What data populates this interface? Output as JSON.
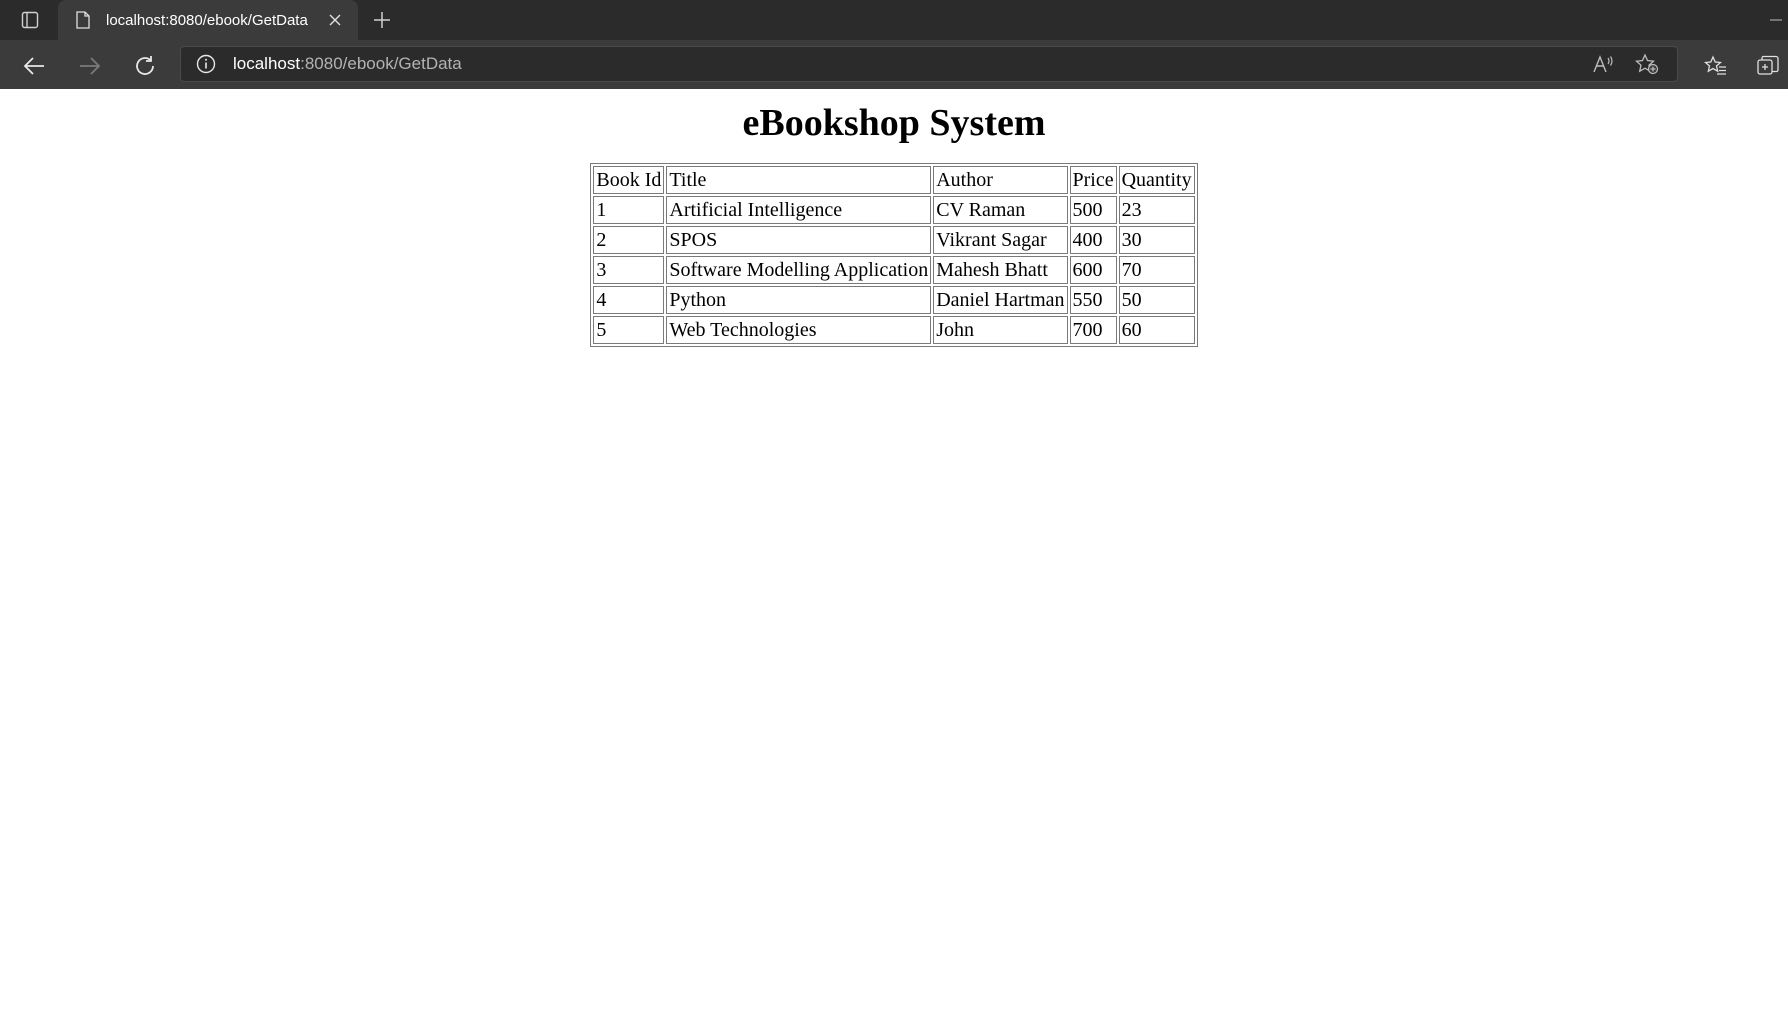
{
  "browser": {
    "tab_title": "localhost:8080/ebook/GetData",
    "url_host": "localhost",
    "url_path": ":8080/ebook/GetData"
  },
  "icons": {
    "tab_actions": "tab-actions-icon",
    "page": "page-icon",
    "close": "close-icon",
    "new_tab": "plus-icon",
    "back": "back-arrow-icon",
    "forward": "forward-arrow-icon",
    "refresh": "refresh-icon",
    "site_info": "info-icon",
    "read_aloud": "read-aloud-icon",
    "add_favorite": "add-favorite-icon",
    "favorites": "favorites-icon",
    "collections": "collections-icon"
  },
  "page": {
    "title": "eBookshop System",
    "table": {
      "headers": [
        "Book Id",
        "Title",
        "Author",
        "Price",
        "Quantity"
      ],
      "rows": [
        [
          "1",
          "Artificial Intelligence",
          "CV Raman",
          "500",
          "23"
        ],
        [
          "2",
          "SPOS",
          "Vikrant Sagar",
          "400",
          "30"
        ],
        [
          "3",
          "Software Modelling Application",
          "Mahesh Bhatt",
          "600",
          "70"
        ],
        [
          "4",
          "Python",
          "Daniel Hartman",
          "550",
          "50"
        ],
        [
          "5",
          "Web Technologies",
          "John",
          "700",
          "60"
        ]
      ]
    }
  }
}
